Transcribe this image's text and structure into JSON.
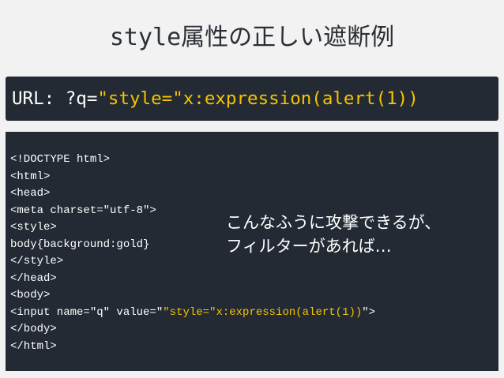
{
  "title": {
    "mono_part": "style",
    "text_part": "属性の正しい遮断例"
  },
  "url_bar": {
    "prefix": "URL: ?q=",
    "value": "\"style=\"x:expression(alert(1))"
  },
  "code_lines": [
    "<!DOCTYPE html>",
    "<html>",
    "<head>",
    "<meta charset=\"utf-8\">",
    "<style>",
    "body{background:gold}",
    "</style>",
    "</head>",
    "<body>",
    "<input name=\"q\" value=\"",
    "</body>",
    "</html>"
  ],
  "input_line": {
    "before": "<input name=\"q\" value=\"",
    "highlight": "\"style=\"x:expression(alert(1))",
    "after": "\">"
  },
  "note": {
    "line1": "こんなふうに攻撃できるが、",
    "line2": "フィルターがあれば…"
  },
  "colors": {
    "background": "#f2f2f2",
    "panel": "#232a33",
    "highlight": "#f5c400",
    "text_light": "#ffffff",
    "title_text": "#2a2f36"
  }
}
